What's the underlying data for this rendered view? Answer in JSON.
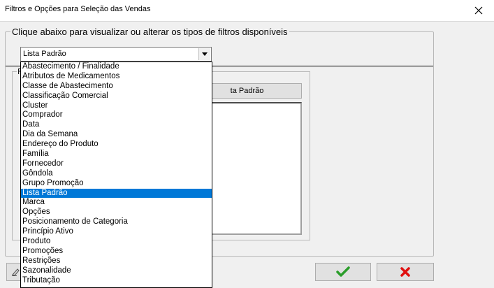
{
  "window": {
    "title": "Filtros e Opções para Seleção das Vendas"
  },
  "filter_group": {
    "legend": "Clique abaixo para visualizar ou alterar os tipos de filtros disponíveis",
    "selected_value": "Lista Padrão",
    "options": [
      "Abastecimento / Finalidade",
      "Atributos de Medicamentos",
      "Classe de Abastecimento",
      "Classificação Comercial",
      "Cluster",
      "Comprador",
      "Data",
      "Dia da Semana",
      "Endereço do Produto",
      "Família",
      "Fornecedor",
      "Gôndola",
      "Grupo Promoção",
      "Lista Padrão",
      "Marca",
      "Opções",
      "Posicionamento de Categoria",
      "Princípio Ativo",
      "Produto",
      "Promoções",
      "Restrições",
      "Sazonalidade",
      "Tributação"
    ],
    "selected_index": 13
  },
  "inner_group": {
    "legend": "F",
    "list_button_label": "ta Padrão"
  },
  "colors": {
    "selection": "#0078d7",
    "ok_check": "#2a9d2a",
    "cancel_x": "#e01010"
  },
  "icons": {
    "close": "close-icon",
    "dropdown": "chevron-down-icon",
    "ok": "checkmark-icon",
    "cancel": "x-icon",
    "clear": "eraser-icon"
  }
}
